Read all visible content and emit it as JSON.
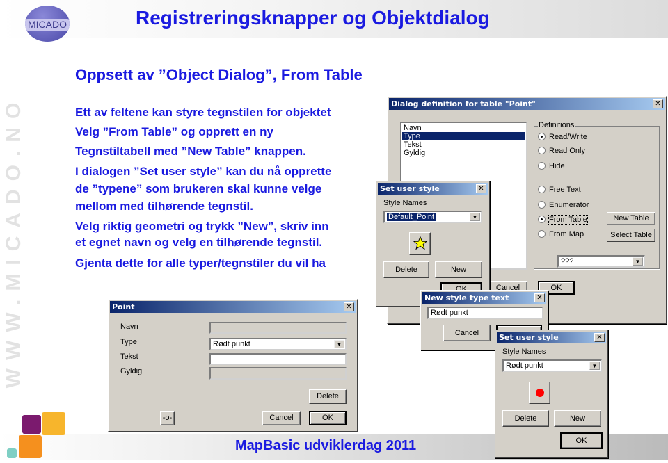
{
  "header": {
    "logo_text": "MICADO",
    "title": "Registreringsknapper og Objektdialog"
  },
  "watermark": "WWW.MICADO.NO",
  "subtitle": "Oppsett av ”Object Dialog”, From Table",
  "lines": [
    "Ett av feltene kan styre tegnstilen for objektet",
    "Velg ”From Table” og opprett en ny",
    "Tegnstiltabell med ”New Table” knappen.",
    "I dialogen ”Set user style” kan du nå opprette",
    "de ”typene” som brukeren skal kunne velge",
    "mellom med tilhørende tegnstil.",
    "Velg riktig geometri og trykk ”New”, skriv inn",
    "et egnet navn og velg en tilhørende tegnstil.",
    "Gjenta dette for alle typer/tegnstiler du vil ha"
  ],
  "footer": "MapBasic udviklerdag 2011",
  "colors": {
    "accent": "#1a1ae0",
    "purple": "#7b1a6e",
    "yellow": "#f7b52c",
    "orange": "#f5901e",
    "teal": "#7fcfc4"
  },
  "main_dialog": {
    "title": "Dialog definition for table \"Point\"",
    "fields": [
      "Navn",
      "Type",
      "Tekst",
      "Gyldig"
    ],
    "selected_field": "Type",
    "group": "Definitions",
    "radios_access": [
      "Read/Write",
      "Read Only",
      "Hide"
    ],
    "access_selected": "Read/Write",
    "radios_source": [
      "Free Text",
      "Enumerator",
      "From Table",
      "From Map"
    ],
    "source_selected": "From Table",
    "new_table": "New Table",
    "select_table": "Select Table",
    "combo_value": "???",
    "ok": "OK",
    "cancel": "Cancel"
  },
  "style_dialog_1": {
    "title": "Set user style",
    "style_names_label": "Style Names",
    "combo_value": "Default_Point",
    "symbol": "yellow-star",
    "delete": "Delete",
    "new": "New",
    "ok": "OK"
  },
  "new_style_dialog": {
    "title": "New style type text",
    "value": "Rødt punkt",
    "cancel": "Cancel",
    "ok": "OK"
  },
  "style_dialog_2": {
    "title": "Set user style",
    "style_names_label": "Style Names",
    "combo_value": "Rødt punkt",
    "symbol": "red-dot",
    "delete": "Delete",
    "new": "New",
    "ok": "OK"
  },
  "point_dialog": {
    "title": "Point",
    "labels": [
      "Navn",
      "Type",
      "Tekst",
      "Gyldig"
    ],
    "type_value": "Rødt punkt",
    "delete": "Delete",
    "symbol_button": "-o-",
    "cancel": "Cancel",
    "ok": "OK"
  }
}
